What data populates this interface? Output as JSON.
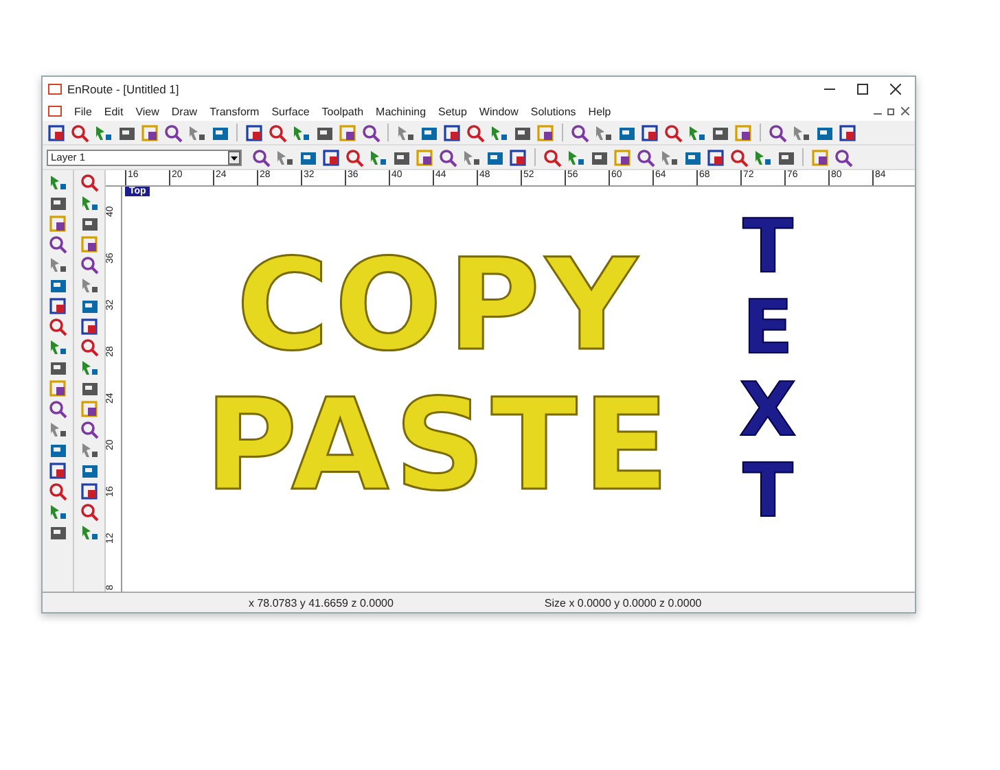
{
  "window": {
    "title": "EnRoute - [Untitled 1]"
  },
  "menu": [
    "File",
    "Edit",
    "View",
    "Draw",
    "Transform",
    "Surface",
    "Toolpath",
    "Machining",
    "Setup",
    "Window",
    "Solutions",
    "Help"
  ],
  "layer_select": {
    "value": "Layer 1"
  },
  "ruler_horizontal": [
    "16",
    "20",
    "24",
    "28",
    "32",
    "36",
    "40",
    "44",
    "48",
    "52",
    "56",
    "60",
    "64",
    "68",
    "72",
    "76",
    "80",
    "84"
  ],
  "ruler_vertical": [
    "40",
    "36",
    "32",
    "28",
    "24",
    "20",
    "16",
    "12",
    "8"
  ],
  "view_label": "Top",
  "canvas": {
    "texts": [
      {
        "text": "COPY",
        "kind": "horizontal",
        "color": "#e6d81e"
      },
      {
        "text": "PASTE",
        "kind": "horizontal",
        "color": "#e6d81e"
      },
      {
        "text": "TEXT",
        "kind": "vertical",
        "color": "#1c1c8c"
      }
    ]
  },
  "status_bar": [
    "x 78.0783 y 41.6659 z 0.0000",
    "Size x 0.0000 y 0.0000 z 0.0000"
  ]
}
